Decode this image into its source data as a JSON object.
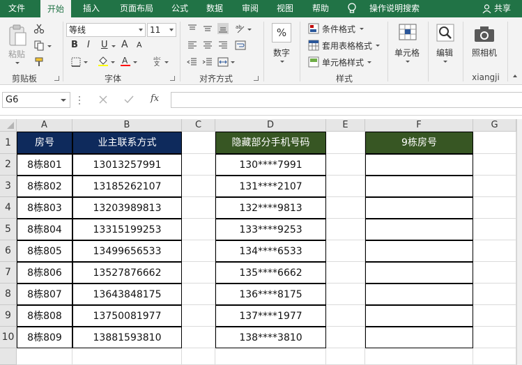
{
  "tabs": [
    {
      "label": "文件",
      "active": false
    },
    {
      "label": "开始",
      "active": true
    },
    {
      "label": "插入",
      "active": false
    },
    {
      "label": "页面布局",
      "active": false
    },
    {
      "label": "公式",
      "active": false
    },
    {
      "label": "数据",
      "active": false
    },
    {
      "label": "审阅",
      "active": false
    },
    {
      "label": "视图",
      "active": false
    },
    {
      "label": "帮助",
      "active": false
    }
  ],
  "tell_me": "操作说明搜索",
  "share": "共享",
  "ribbon": {
    "clipboard": {
      "paste_label": "粘贴",
      "group_label": "剪贴板"
    },
    "font": {
      "font_name": "等线",
      "font_size": "11",
      "bold": "B",
      "italic": "I",
      "underline": "U",
      "grow": "A",
      "shrink": "A",
      "group_label": "字体"
    },
    "alignment": {
      "group_label": "对齐方式"
    },
    "number": {
      "label": "数字",
      "symbol": "%"
    },
    "styles": {
      "conditional": "条件格式",
      "table": "套用表格格式",
      "cell_styles": "单元格样式",
      "group_label": "样式"
    },
    "cells": {
      "label": "单元格"
    },
    "editing": {
      "label": "编辑"
    },
    "camera": {
      "label": "照相机",
      "group_label": "xiangji"
    }
  },
  "formula_bar": {
    "name_box": "G6",
    "fx": "fx",
    "value": ""
  },
  "colors": {
    "accent": "#217346",
    "header_blue": "#0e2a5c",
    "header_green": "#375623"
  },
  "columns": [
    "A",
    "B",
    "C",
    "D",
    "E",
    "F",
    "G"
  ],
  "rows": [
    "1",
    "2",
    "3",
    "4",
    "5",
    "6",
    "7",
    "8",
    "9",
    "10"
  ],
  "sheet": {
    "A1": "房号",
    "B1": "业主联系方式",
    "D1": "隐藏部分手机号码",
    "F1": "9栋房号",
    "A2": "8栋801",
    "A3": "8栋802",
    "A4": "8栋803",
    "A5": "8栋804",
    "A6": "8栋805",
    "A7": "8栋806",
    "A8": "8栋807",
    "A9": "8栋808",
    "A10": "8栋809",
    "B2": "13013257991",
    "B3": "13185262107",
    "B4": "13203989813",
    "B5": "13315199253",
    "B6": "13499656533",
    "B7": "13527876662",
    "B8": "13643848175",
    "B9": "13750081977",
    "B10": "13881593810",
    "D2": "130****7991",
    "D3": "131****2107",
    "D4": "132****9813",
    "D5": "133****9253",
    "D6": "134****6533",
    "D7": "135****6662",
    "D8": "136****8175",
    "D9": "137****1977",
    "D10": "138****3810"
  }
}
